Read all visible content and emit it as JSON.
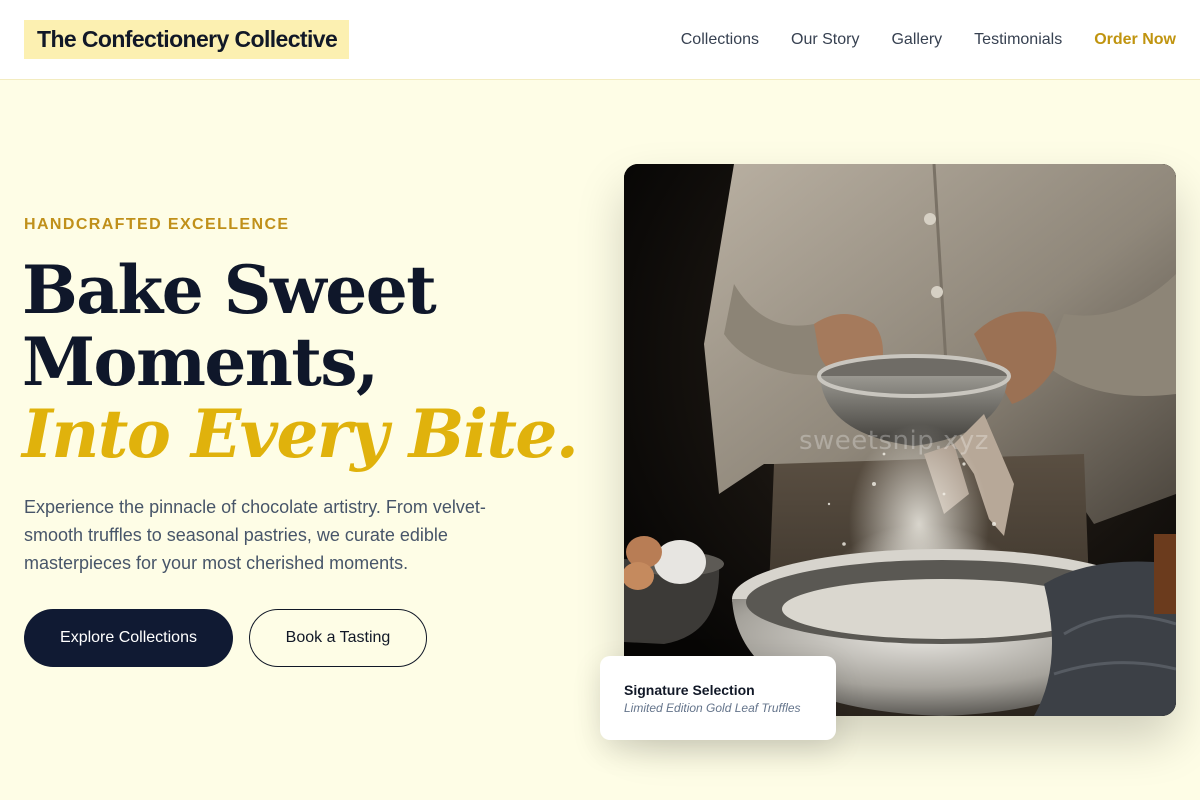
{
  "header": {
    "logo": "The Confectionery Collective",
    "nav": [
      {
        "label": "Collections"
      },
      {
        "label": "Our Story"
      },
      {
        "label": "Gallery"
      },
      {
        "label": "Testimonials"
      }
    ],
    "cta": "Order Now"
  },
  "hero": {
    "eyebrow": "HANDCRAFTED EXCELLENCE",
    "headline_line1": "Bake Sweet",
    "headline_line2": "Moments,",
    "headline_accent": "Into Every Bite.",
    "lede": "Experience the pinnacle of chocolate artistry. From velvet-smooth truffles to seasonal pastries, we curate edible masterpieces for your most cherished moments.",
    "primary_button": "Explore Collections",
    "secondary_button": "Book a Tasting"
  },
  "image": {
    "watermark": "sweetsnip.xyz"
  },
  "signature_card": {
    "title": "Signature Selection",
    "subtitle": "Limited Edition Gold Leaf Truffles"
  },
  "colors": {
    "background": "#fefde6",
    "accent": "#e0b20c",
    "nav_cta": "#c0940f",
    "primary_button": "#101a33"
  }
}
